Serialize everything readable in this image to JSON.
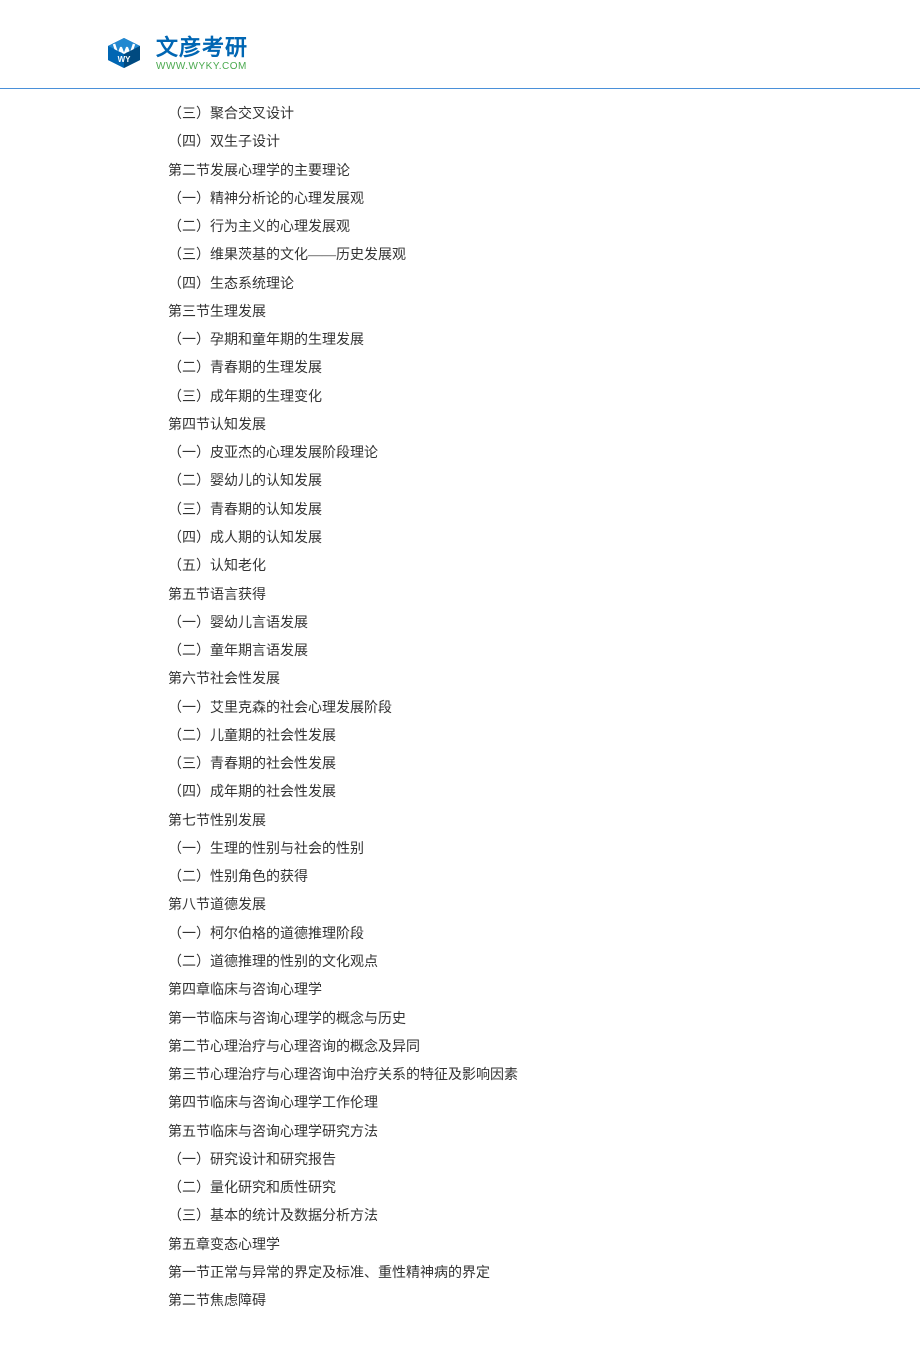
{
  "logo": {
    "title": "文彦考研",
    "subtitle": "WWW.WYKY.COM"
  },
  "content": {
    "lines": [
      "（三）聚合交叉设计",
      "（四）双生子设计",
      "第二节发展心理学的主要理论",
      "（一）精神分析论的心理发展观",
      "（二）行为主义的心理发展观",
      "（三）维果茨基的文化——历史发展观",
      "（四）生态系统理论",
      "第三节生理发展",
      "（一）孕期和童年期的生理发展",
      "（二）青春期的生理发展",
      "（三）成年期的生理变化",
      "第四节认知发展",
      "（一）皮亚杰的心理发展阶段理论",
      "（二）婴幼儿的认知发展",
      "（三）青春期的认知发展",
      "（四）成人期的认知发展",
      "（五）认知老化",
      "第五节语言获得",
      "（一）婴幼儿言语发展",
      "（二）童年期言语发展",
      "第六节社会性发展",
      "（一）艾里克森的社会心理发展阶段",
      "（二）儿童期的社会性发展",
      "（三）青春期的社会性发展",
      "（四）成年期的社会性发展",
      "第七节性别发展",
      "（一）生理的性别与社会的性别",
      "（二）性别角色的获得",
      "第八节道德发展",
      "（一）柯尔伯格的道德推理阶段",
      "（二）道德推理的性别的文化观点",
      "第四章临床与咨询心理学",
      "第一节临床与咨询心理学的概念与历史",
      "第二节心理治疗与心理咨询的概念及异同",
      "第三节心理治疗与心理咨询中治疗关系的特征及影响因素",
      "第四节临床与咨询心理学工作伦理",
      "第五节临床与咨询心理学研究方法",
      "（一）研究设计和研究报告",
      "（二）量化研究和质性研究",
      "（三）基本的统计及数据分析方法",
      "第五章变态心理学",
      "第一节正常与异常的界定及标准、重性精神病的界定",
      "第二节焦虑障碍"
    ]
  }
}
